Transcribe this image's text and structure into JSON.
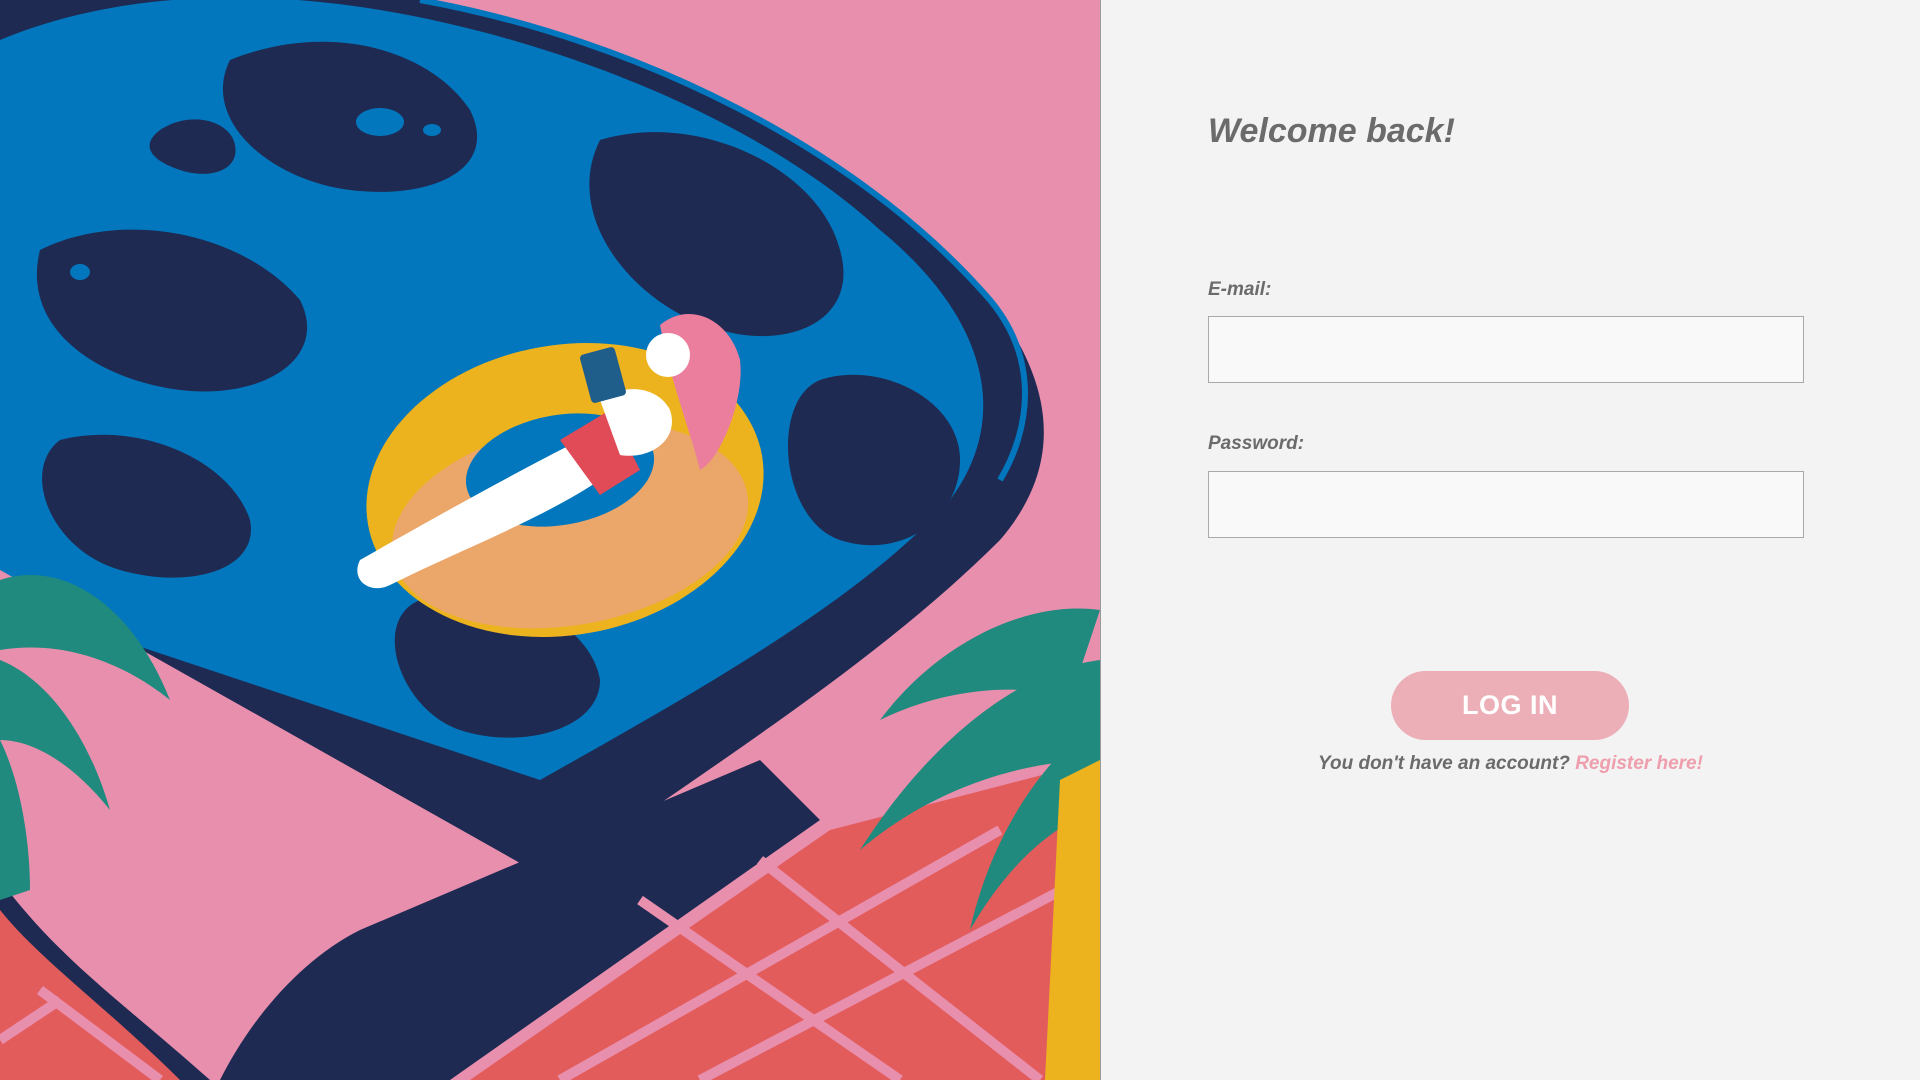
{
  "illustration": {
    "icon": "pool-float-illustration",
    "colors": {
      "pink": "#e88fae",
      "navy": "#1e2a52",
      "water": "#0377bd",
      "float": "#ecb31f",
      "palm": "#1f8a7d",
      "tile": "#e35c5c"
    }
  },
  "form": {
    "welcome": "Welcome back!",
    "email_label": "E-mail:",
    "email_value": "",
    "password_label": "Password:",
    "password_value": "",
    "login_label": "LOG IN",
    "register_prompt": "You don't have an account?",
    "register_link": "Register here!"
  },
  "colors": {
    "background": "#f3f3f3",
    "text": "#6b6b6b",
    "button": "#ecafb7",
    "link": "#ee9eac"
  }
}
